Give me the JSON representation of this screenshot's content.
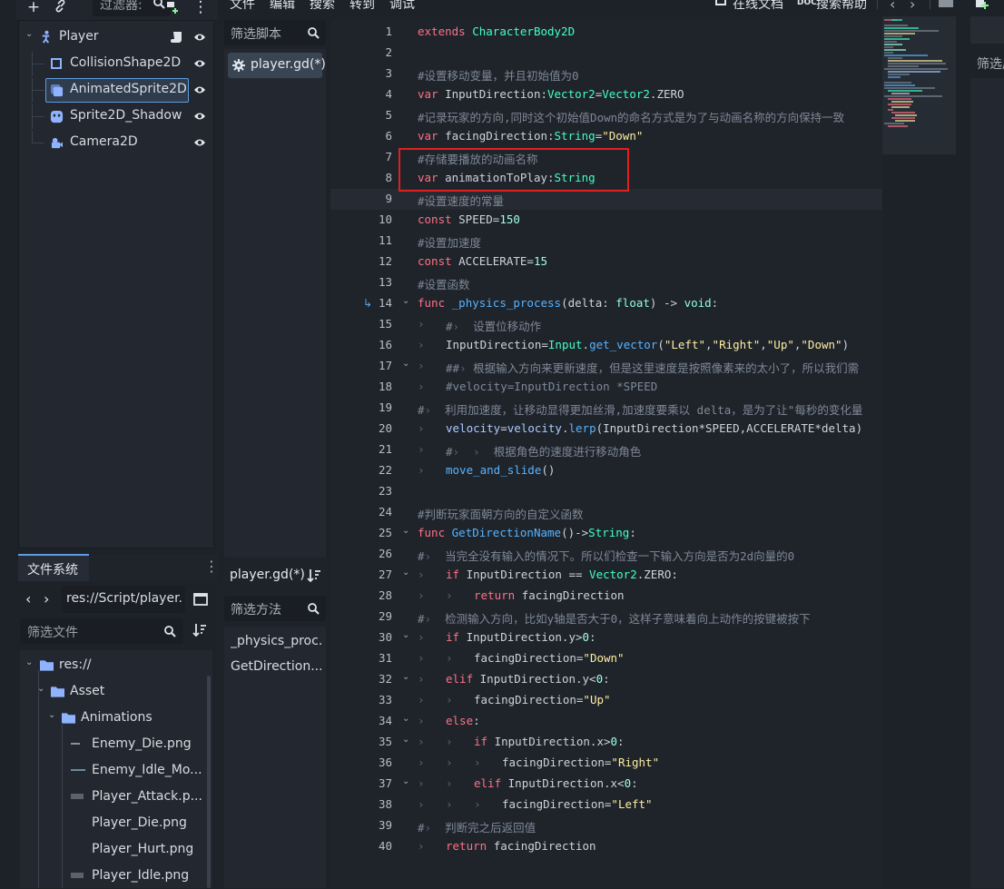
{
  "scene_dock": {
    "filter_placeholder": "过滤器:",
    "nodes": [
      {
        "label": "Player",
        "icon": "character-body-icon"
      },
      {
        "label": "CollisionShape2D",
        "icon": "collision-shape-icon"
      },
      {
        "label": "AnimatedSprite2D",
        "icon": "animated-sprite-icon"
      },
      {
        "label": "Sprite2D_Shadow",
        "icon": "sprite-icon"
      },
      {
        "label": "Camera2D",
        "icon": "camera-icon"
      }
    ]
  },
  "filesystem": {
    "tab_label": "文件系统",
    "path": "res://Script/player.",
    "filter_placeholder": "筛选文件",
    "items": [
      {
        "label": "res://"
      },
      {
        "label": "Asset"
      },
      {
        "label": "Animations"
      },
      {
        "label": "Enemy_Die.png"
      },
      {
        "label": "Enemy_Idle_Mo..."
      },
      {
        "label": "Player_Attack.p..."
      },
      {
        "label": "Player_Die.png"
      },
      {
        "label": "Player_Hurt.png"
      },
      {
        "label": "Player_Idle.png"
      }
    ]
  },
  "menu": {
    "file": "文件",
    "edit": "编辑",
    "search": "搜索",
    "goto": "转到",
    "debug": "调试",
    "online_docs": "在线文档",
    "search_help": "搜索帮助",
    "doc_badge": "DOC"
  },
  "script_panel": {
    "filter_placeholder": "筛选脚本",
    "scripts": [
      "player.gd(*)"
    ],
    "current_script": "player.gd(*)",
    "method_filter_placeholder": "筛选方法",
    "methods": [
      "_physics_proc...",
      "GetDirection..."
    ]
  },
  "right_dock": {
    "label": "筛选属"
  },
  "editor": {
    "current_line": 9,
    "lines": [
      {
        "n": "1",
        "indent": 0,
        "t": [
          [
            "kw",
            "extends "
          ],
          [
            "ty",
            "CharacterBody2D"
          ]
        ]
      },
      {
        "n": "2",
        "indent": 0,
        "t": []
      },
      {
        "n": "3",
        "indent": 0,
        "t": [
          [
            "cm",
            "#设置移动变量，并且初始值为0"
          ]
        ]
      },
      {
        "n": "4",
        "indent": 0,
        "t": [
          [
            "kw",
            "var "
          ],
          [
            "id",
            "InputDirection"
          ],
          [
            "id",
            ":"
          ],
          [
            "ty",
            "Vector2"
          ],
          [
            "id",
            "="
          ],
          [
            "ty",
            "Vector2"
          ],
          [
            "id",
            "."
          ],
          [
            "id",
            "ZERO"
          ]
        ]
      },
      {
        "n": "5",
        "indent": 0,
        "t": [
          [
            "cm",
            "#记录玩家的方向,同时这个初始值Down的命名方式是为了与动画名称的方向保持一致"
          ]
        ]
      },
      {
        "n": "6",
        "indent": 0,
        "t": [
          [
            "kw",
            "var "
          ],
          [
            "id",
            "facingDirection"
          ],
          [
            "id",
            ":"
          ],
          [
            "ty",
            "String"
          ],
          [
            "id",
            "="
          ],
          [
            "st",
            "\"Down\""
          ]
        ]
      },
      {
        "n": "7",
        "indent": 0,
        "t": [
          [
            "cm",
            "#存储要播放的动画名称"
          ]
        ]
      },
      {
        "n": "8",
        "indent": 0,
        "t": [
          [
            "kw",
            "var "
          ],
          [
            "id",
            "animationToPlay"
          ],
          [
            "id",
            ":"
          ],
          [
            "ty",
            "String"
          ]
        ]
      },
      {
        "n": "9",
        "indent": 0,
        "t": [
          [
            "cm",
            "#设置速度的常量"
          ]
        ]
      },
      {
        "n": "10",
        "indent": 0,
        "t": [
          [
            "kw",
            "const "
          ],
          [
            "id",
            "SPEED"
          ],
          [
            "id",
            "="
          ],
          [
            "nm",
            "150"
          ]
        ]
      },
      {
        "n": "11",
        "indent": 0,
        "t": [
          [
            "cm",
            "#设置加速度"
          ]
        ]
      },
      {
        "n": "12",
        "indent": 0,
        "t": [
          [
            "kw",
            "const "
          ],
          [
            "id",
            "ACCELERATE"
          ],
          [
            "id",
            "="
          ],
          [
            "nm",
            "15"
          ]
        ]
      },
      {
        "n": "13",
        "indent": 0,
        "t": [
          [
            "cm",
            "#设置函数"
          ]
        ]
      },
      {
        "n": "14",
        "indent": 0,
        "fold": true,
        "bookmark": true,
        "t": [
          [
            "kw",
            "func "
          ],
          [
            "fn",
            "_physics_process"
          ],
          [
            "id",
            "(delta: "
          ],
          [
            "tyd",
            "float"
          ],
          [
            "id",
            ") -> "
          ],
          [
            "tyd",
            "void"
          ],
          [
            "id",
            ":"
          ]
        ]
      },
      {
        "n": "15",
        "indent": 1,
        "t": [
          [
            "cm",
            "#"
          ],
          [
            "tg",
            "›"
          ],
          [
            "cm",
            "  设置位移动作"
          ]
        ]
      },
      {
        "n": "16",
        "indent": 1,
        "t": [
          [
            "id",
            "InputDirection"
          ],
          [
            "id",
            "="
          ],
          [
            "ty",
            "Input"
          ],
          [
            "id",
            "."
          ],
          [
            "fn",
            "get_vector"
          ],
          [
            "id",
            "("
          ],
          [
            "st",
            "\"Left\""
          ],
          [
            "id",
            ","
          ],
          [
            "st",
            "\"Right\""
          ],
          [
            "id",
            ","
          ],
          [
            "st",
            "\"Up\""
          ],
          [
            "id",
            ","
          ],
          [
            "st",
            "\"Down\""
          ],
          [
            "id",
            ")"
          ]
        ]
      },
      {
        "n": "17",
        "indent": 1,
        "fold": true,
        "t": [
          [
            "cm",
            "##"
          ],
          [
            "tg",
            "›"
          ],
          [
            "cm",
            " 根据输入方向来更新速度，但是这里速度是按照像素来的太小了，所以我们需"
          ]
        ]
      },
      {
        "n": "18",
        "indent": 1,
        "t": [
          [
            "cm",
            "#velocity=InputDirection *SPEED"
          ]
        ]
      },
      {
        "n": "19",
        "indent": 0,
        "t": [
          [
            "cm",
            "#"
          ],
          [
            "tg",
            "›"
          ],
          [
            "cm",
            "  利用加速度，让移动显得更加丝滑,加速度要乘以 delta，是为了让\"每秒的变化量"
          ]
        ]
      },
      {
        "n": "20",
        "indent": 1,
        "t": [
          [
            "pl",
            "velocity"
          ],
          [
            "id",
            "="
          ],
          [
            "pl",
            "velocity"
          ],
          [
            "id",
            "."
          ],
          [
            "fn",
            "lerp"
          ],
          [
            "id",
            "(InputDirection*SPEED,ACCELERATE*delta)"
          ]
        ]
      },
      {
        "n": "21",
        "indent": 1,
        "t": [
          [
            "cm",
            "#"
          ],
          [
            "tg",
            "›"
          ],
          [
            "cm",
            "  "
          ],
          [
            "tg",
            "›"
          ],
          [
            "cm",
            "  根据角色的速度进行移动角色"
          ]
        ]
      },
      {
        "n": "22",
        "indent": 1,
        "t": [
          [
            "fn",
            "move_and_slide"
          ],
          [
            "id",
            "()"
          ]
        ]
      },
      {
        "n": "23",
        "indent": 0,
        "t": []
      },
      {
        "n": "24",
        "indent": 0,
        "t": [
          [
            "cm",
            "#判断玩家面朝方向的自定义函数"
          ]
        ]
      },
      {
        "n": "25",
        "indent": 0,
        "fold": true,
        "t": [
          [
            "kw",
            "func "
          ],
          [
            "fn",
            "GetDirectionName"
          ],
          [
            "id",
            "()->"
          ],
          [
            "ty",
            "String"
          ],
          [
            "id",
            ":"
          ]
        ]
      },
      {
        "n": "26",
        "indent": 0,
        "t": [
          [
            "cm",
            "#"
          ],
          [
            "tg",
            "›"
          ],
          [
            "cm",
            "  当完全没有输入的情况下。所以们检查一下输入方向是否为2d向量的0"
          ]
        ]
      },
      {
        "n": "27",
        "indent": 1,
        "fold": true,
        "t": [
          [
            "kw",
            "if "
          ],
          [
            "id",
            "InputDirection == "
          ],
          [
            "ty",
            "Vector2"
          ],
          [
            "id",
            "."
          ],
          [
            "id",
            "ZERO:"
          ]
        ]
      },
      {
        "n": "28",
        "indent": 2,
        "t": [
          [
            "kw",
            "return "
          ],
          [
            "id",
            "facingDirection"
          ]
        ]
      },
      {
        "n": "29",
        "indent": 0,
        "t": [
          [
            "cm",
            "#"
          ],
          [
            "tg",
            "›"
          ],
          [
            "cm",
            "  检测输入方向，比如y轴是否大于0，这样子意味着向上动作的按键被按下"
          ]
        ]
      },
      {
        "n": "30",
        "indent": 1,
        "fold": true,
        "t": [
          [
            "kw",
            "if "
          ],
          [
            "id",
            "InputDirection.y>"
          ],
          [
            "nm",
            "0"
          ],
          [
            "id",
            ":"
          ]
        ]
      },
      {
        "n": "31",
        "indent": 2,
        "t": [
          [
            "id",
            "facingDirection="
          ],
          [
            "st",
            "\"Down\""
          ]
        ]
      },
      {
        "n": "32",
        "indent": 1,
        "fold": true,
        "t": [
          [
            "kw",
            "elif "
          ],
          [
            "id",
            "InputDirection.y<"
          ],
          [
            "nm",
            "0"
          ],
          [
            "id",
            ":"
          ]
        ]
      },
      {
        "n": "33",
        "indent": 2,
        "t": [
          [
            "id",
            "facingDirection="
          ],
          [
            "st",
            "\"Up\""
          ]
        ]
      },
      {
        "n": "34",
        "indent": 1,
        "fold": true,
        "t": [
          [
            "kw",
            "else"
          ],
          [
            "id",
            ":"
          ]
        ]
      },
      {
        "n": "35",
        "indent": 2,
        "fold": true,
        "t": [
          [
            "kw",
            "if "
          ],
          [
            "id",
            "InputDirection.x>"
          ],
          [
            "nm",
            "0"
          ],
          [
            "id",
            ":"
          ]
        ]
      },
      {
        "n": "36",
        "indent": 3,
        "t": [
          [
            "id",
            "facingDirection="
          ],
          [
            "st",
            "\"Right\""
          ]
        ]
      },
      {
        "n": "37",
        "indent": 2,
        "fold": true,
        "t": [
          [
            "kw",
            "elif "
          ],
          [
            "id",
            "InputDirection.x<"
          ],
          [
            "nm",
            "0"
          ],
          [
            "id",
            ":"
          ]
        ]
      },
      {
        "n": "38",
        "indent": 3,
        "t": [
          [
            "id",
            "facingDirection="
          ],
          [
            "st",
            "\"Left\""
          ]
        ]
      },
      {
        "n": "39",
        "indent": 0,
        "t": [
          [
            "cm",
            "#"
          ],
          [
            "tg",
            "›"
          ],
          [
            "cm",
            "  判断完之后返回值"
          ]
        ]
      },
      {
        "n": "40",
        "indent": 1,
        "t": [
          [
            "kw",
            "return "
          ],
          [
            "id",
            "facingDirection"
          ]
        ]
      }
    ]
  },
  "colors": {
    "accent": "#5f9ce0",
    "highlight_box": "#e0201f",
    "keyword": "#ff7085",
    "type": "#42ffc2",
    "string": "#ffeda1",
    "comment": "#7e8896",
    "function": "#57b3ff"
  }
}
